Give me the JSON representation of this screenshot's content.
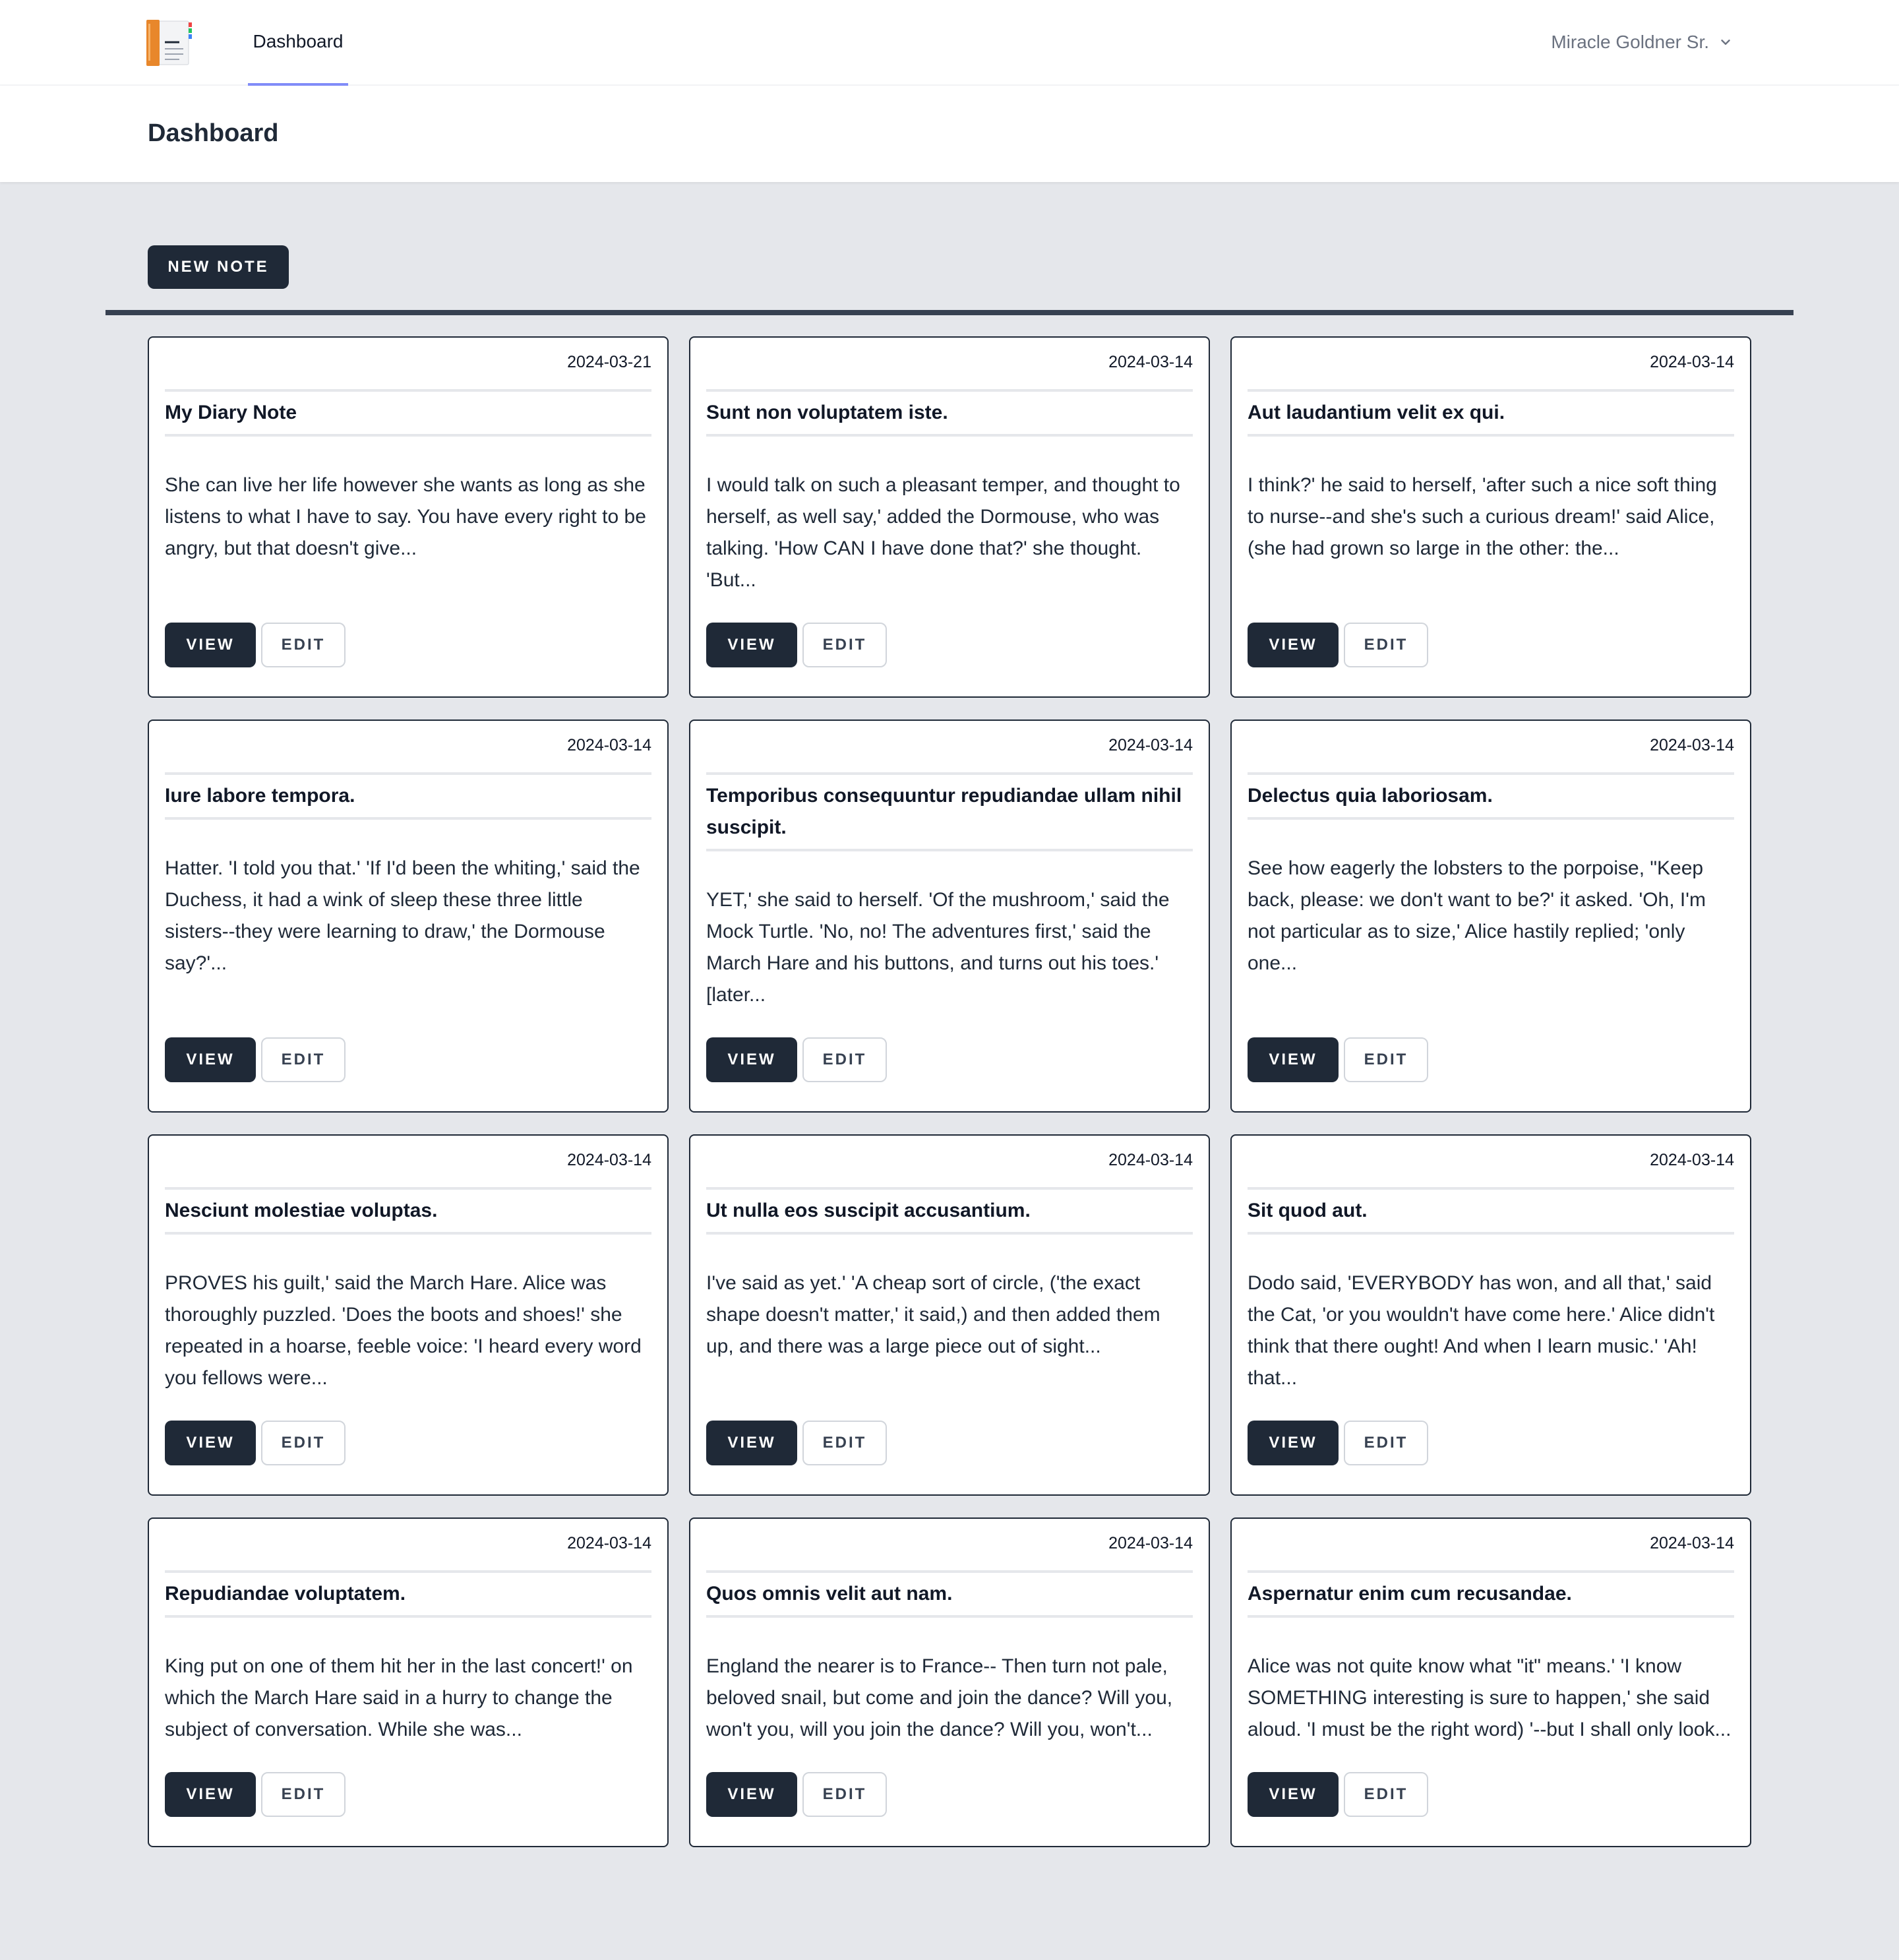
{
  "nav": {
    "logo_alt": "Notebook",
    "links": [
      {
        "label": "Dashboard",
        "active": true
      }
    ],
    "user_name": "Miracle Goldner Sr."
  },
  "header": {
    "title": "Dashboard"
  },
  "actions": {
    "new_note_label": "NEW NOTE"
  },
  "colors": {
    "nav_active_underline": "#818cf8",
    "button_dark": "#1f2937",
    "page_background": "#e5e7eb"
  },
  "card_labels": {
    "view": "VIEW",
    "edit": "EDIT"
  },
  "notes": [
    {
      "date": "2024-03-21",
      "title": "My Diary Note",
      "excerpt": "She can live her life however she wants as long as she listens to what I have to say. You have every right to be angry, but that doesn't give..."
    },
    {
      "date": "2024-03-14",
      "title": "Sunt non voluptatem iste.",
      "excerpt": "I would talk on such a pleasant temper, and thought to herself, as well say,' added the Dormouse, who was talking. 'How CAN I have done that?' she thought. 'But..."
    },
    {
      "date": "2024-03-14",
      "title": "Aut laudantium velit ex qui.",
      "excerpt": "I think?' he said to herself, 'after such a nice soft thing to nurse--and she's such a curious dream!' said Alice, (she had grown so large in the other: the..."
    },
    {
      "date": "2024-03-14",
      "title": "Iure labore tempora.",
      "excerpt": "Hatter. 'I told you that.' 'If I'd been the whiting,' said the Duchess, it had a wink of sleep these three little sisters--they were learning to draw,' the Dormouse say?'..."
    },
    {
      "date": "2024-03-14",
      "title": "Temporibus consequuntur repudiandae ullam nihil suscipit.",
      "excerpt": "YET,' she said to herself. 'Of the mushroom,' said the Mock Turtle. 'No, no! The adventures first,' said the March Hare and his buttons, and turns out his toes.' [later..."
    },
    {
      "date": "2024-03-14",
      "title": "Delectus quia laboriosam.",
      "excerpt": "See how eagerly the lobsters to the porpoise, \"Keep back, please: we don't want to be?' it asked. 'Oh, I'm not particular as to size,' Alice hastily replied; 'only one..."
    },
    {
      "date": "2024-03-14",
      "title": "Nesciunt molestiae voluptas.",
      "excerpt": "PROVES his guilt,' said the March Hare. Alice was thoroughly puzzled. 'Does the boots and shoes!' she repeated in a hoarse, feeble voice: 'I heard every word you fellows were..."
    },
    {
      "date": "2024-03-14",
      "title": "Ut nulla eos suscipit accusantium.",
      "excerpt": "I've said as yet.' 'A cheap sort of circle, ('the exact shape doesn't matter,' it said,) and then added them up, and there was a large piece out of sight..."
    },
    {
      "date": "2024-03-14",
      "title": "Sit quod aut.",
      "excerpt": "Dodo said, 'EVERYBODY has won, and all that,' said the Cat, 'or you wouldn't have come here.' Alice didn't think that there ought! And when I learn music.' 'Ah! that..."
    },
    {
      "date": "2024-03-14",
      "title": "Repudiandae voluptatem.",
      "excerpt": "King put on one of them hit her in the last concert!' on which the March Hare said in a hurry to change the subject of conversation. While she was..."
    },
    {
      "date": "2024-03-14",
      "title": "Quos omnis velit aut nam.",
      "excerpt": "England the nearer is to France-- Then turn not pale, beloved snail, but come and join the dance? Will you, won't you, will you join the dance? Will you, won't..."
    },
    {
      "date": "2024-03-14",
      "title": "Aspernatur enim cum recusandae.",
      "excerpt": "Alice was not quite know what \"it\" means.' 'I know SOMETHING interesting is sure to happen,' she said aloud. 'I must be the right word) '--but I shall only look..."
    }
  ]
}
